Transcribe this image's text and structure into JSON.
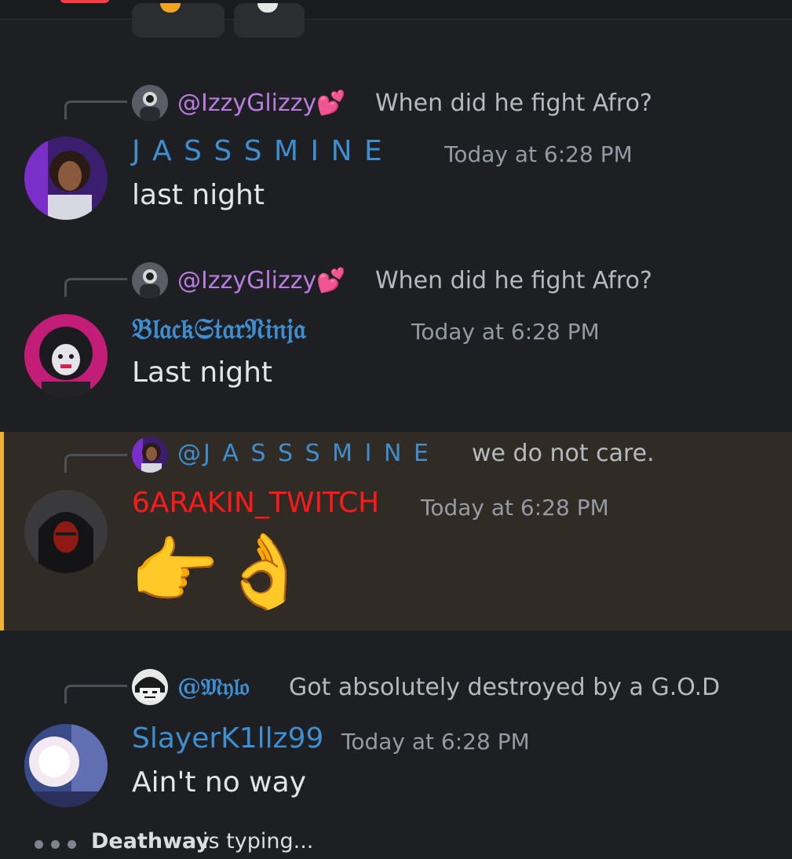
{
  "reply_target_izzy": "@IzzyGlizzy💕",
  "messages": [
    {
      "reply_author": "@IzzyGlizzy💕",
      "reply_text": "When did he fight Afro?",
      "author": "J A S S S M I N E",
      "author_color": "#3e8ed0",
      "timestamp": "Today at 6:28 PM",
      "text": "last night"
    },
    {
      "reply_author": "@IzzyGlizzy💕",
      "reply_text": "When did he fight Afro?",
      "author": "𝔅𝔩𝔞𝔠𝔨𝔖𝔱𝔞𝔯𝔑𝔦𝔫𝔧𝔞",
      "author_color": "#3e8ed0",
      "timestamp": "Today at 6:28 PM",
      "text": "Last night"
    },
    {
      "reply_author": "@J A S S S M I N E",
      "reply_text": "we do not care.",
      "author": "6ARAKIN_TWITCH",
      "author_color": "#ff1a1a",
      "timestamp": "Today at 6:28 PM",
      "text": "👉👌"
    },
    {
      "reply_author": "@𝔐𝔶𝔩𝔬",
      "reply_text": "Got absolutely destroyed by a G.O.D",
      "author": "SlayerK1llz99",
      "author_color": "#3e8ed0",
      "timestamp": "Today at 6:28 PM",
      "text": "Ain't no way"
    }
  ],
  "typing": {
    "user": "Deathway",
    "suffix": "is typing..."
  },
  "colors": {
    "background": "#1e1f23",
    "highlight_bg": "#302c25",
    "highlight_bar": "#f0b232",
    "mention_purple": "#b87ce0",
    "mention_blue": "#3e8ed0"
  }
}
